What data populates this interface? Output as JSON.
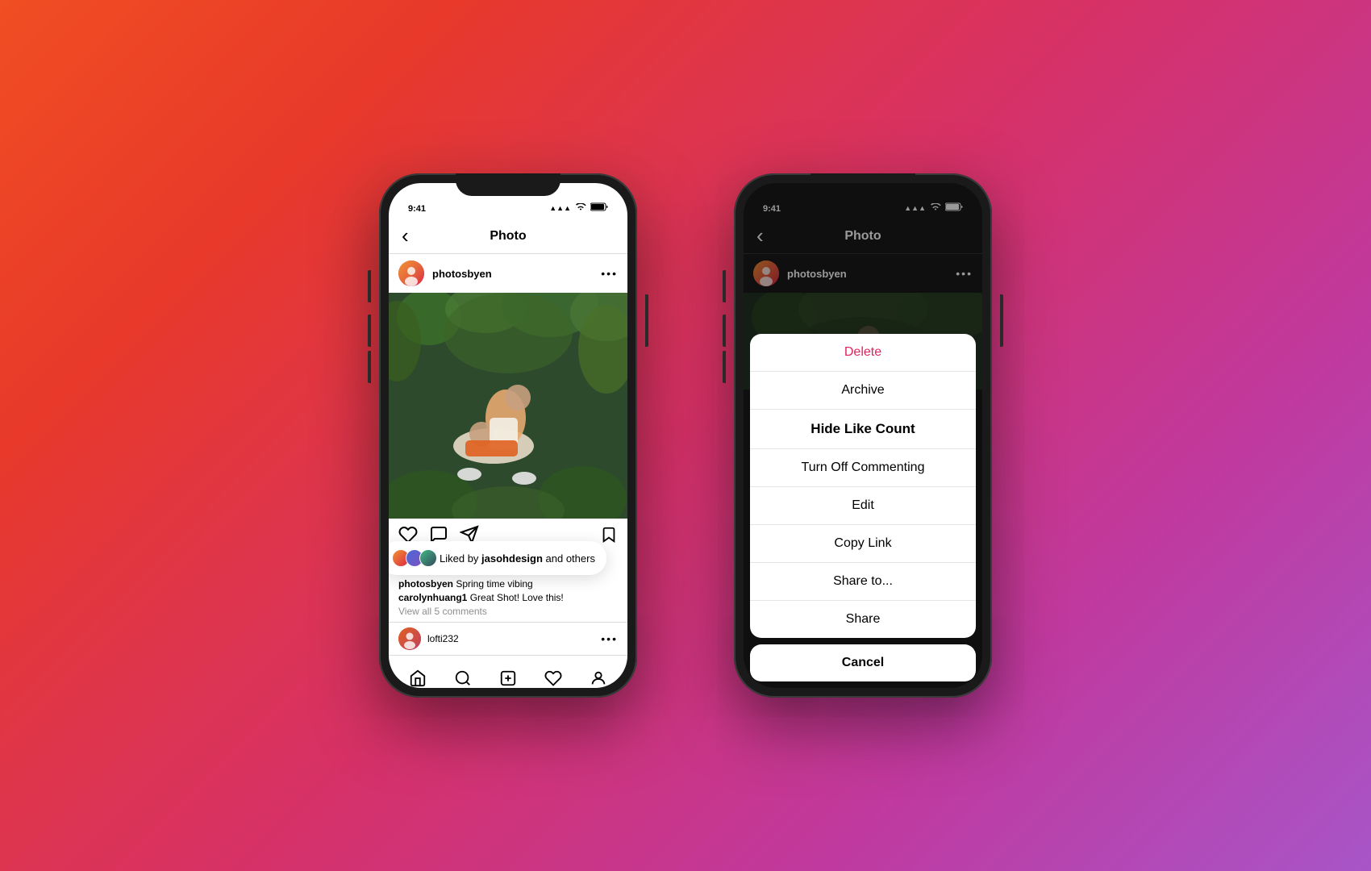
{
  "background": {
    "gradient_start": "#f04e23",
    "gradient_end": "#a855c8"
  },
  "phone_left": {
    "status_bar": {
      "time": "9:41",
      "signal": "●●●●",
      "wifi": "wifi",
      "battery": "battery"
    },
    "nav": {
      "title": "Photo",
      "back_icon": "‹"
    },
    "post": {
      "username": "photosbyen",
      "more_icon": "•••"
    },
    "actions": {
      "like_icon": "♡",
      "comment_icon": "💬",
      "share_icon": "➤",
      "bookmark_icon": "🔖"
    },
    "liked_bubble": {
      "text_prefix": "Liked by ",
      "username": "jasohdesign",
      "text_suffix": " and others"
    },
    "caption": {
      "username": "photosbyen",
      "text": "Spring time vibing"
    },
    "comments": [
      {
        "username": "carolynhuang1",
        "text": "Great Shot! Love this!"
      }
    ],
    "view_comments": "View all 5 comments",
    "comment_input": {
      "commenter_username": "lofti232",
      "more_icon": "•••"
    },
    "bottom_nav": {
      "home": "⌂",
      "search": "⌕",
      "add": "⊕",
      "heart": "♡",
      "profile": "👤"
    }
  },
  "phone_right": {
    "status_bar": {
      "time": "9:41",
      "signal": "●●●●",
      "wifi": "wifi",
      "battery": "battery"
    },
    "nav": {
      "title": "Photo",
      "back_icon": "‹"
    },
    "post": {
      "username": "photosbyen",
      "more_icon": "•••"
    },
    "action_sheet": {
      "items": [
        {
          "label": "Delete",
          "type": "destructive"
        },
        {
          "label": "Archive",
          "type": "normal"
        },
        {
          "label": "Hide Like Count",
          "type": "selected"
        },
        {
          "label": "Turn Off Commenting",
          "type": "normal"
        },
        {
          "label": "Edit",
          "type": "normal"
        },
        {
          "label": "Copy Link",
          "type": "normal"
        },
        {
          "label": "Share to...",
          "type": "normal"
        },
        {
          "label": "Share",
          "type": "normal"
        }
      ],
      "cancel_label": "Cancel"
    }
  }
}
